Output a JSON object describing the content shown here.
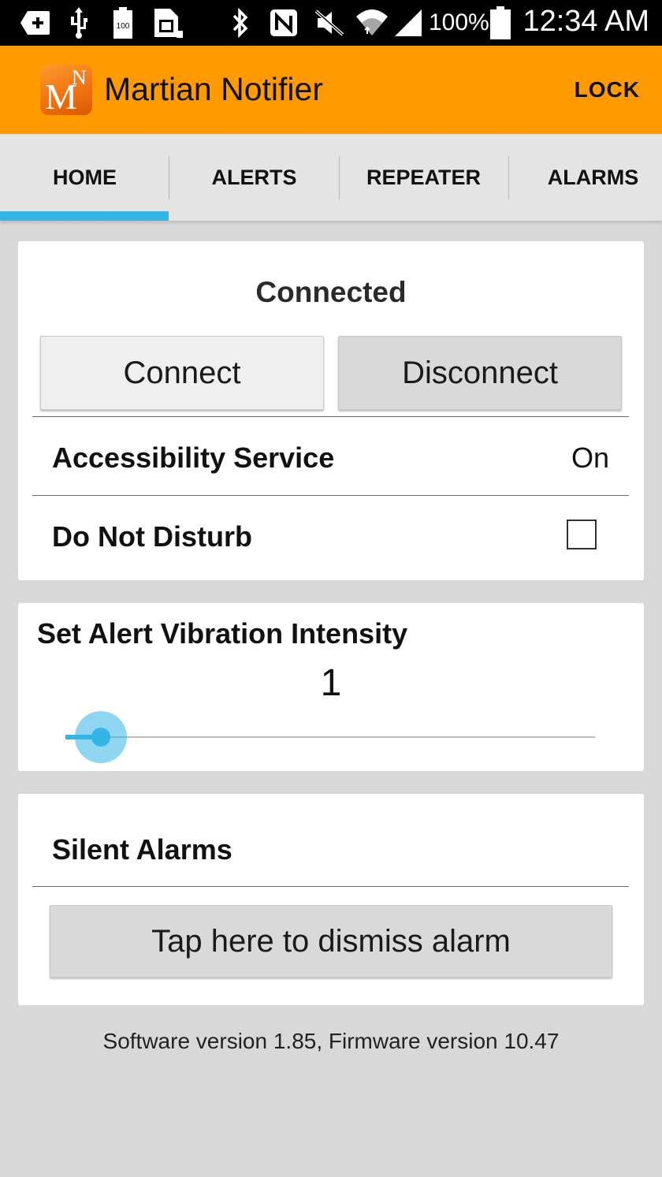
{
  "statusbar": {
    "battery_text": "100%",
    "time": "12:34 AM",
    "icons": [
      "add-box-icon",
      "usb-icon",
      "battery-100-icon",
      "sim-icon",
      "bluetooth-icon",
      "nfc-icon",
      "mute-icon",
      "wifi-icon",
      "signal-icon",
      "battery-icon"
    ]
  },
  "actionbar": {
    "title": "Martian Notifier",
    "logo_letters": {
      "m": "M",
      "n": "N"
    },
    "lock_label": "LOCK",
    "background_color": "#ff9a00"
  },
  "tabs": {
    "items": [
      {
        "label": "HOME"
      },
      {
        "label": "ALERTS"
      },
      {
        "label": "REPEATER"
      },
      {
        "label": "ALARMS"
      }
    ],
    "active_index": 0,
    "indicator_color": "#33b5e5"
  },
  "connection": {
    "status": "Connected",
    "connect_label": "Connect",
    "disconnect_label": "Disconnect",
    "accessibility_label": "Accessibility Service",
    "accessibility_value": "On",
    "dnd_label": "Do Not Disturb",
    "dnd_checked": false
  },
  "vibration": {
    "title": "Set Alert Vibration Intensity",
    "value": "1",
    "slider_fraction": 0.0
  },
  "alarms": {
    "title": "Silent Alarms",
    "dismiss_label": "Tap here to dismiss alarm"
  },
  "footer": {
    "version_text": "Software version 1.85, Firmware version 10.47"
  }
}
